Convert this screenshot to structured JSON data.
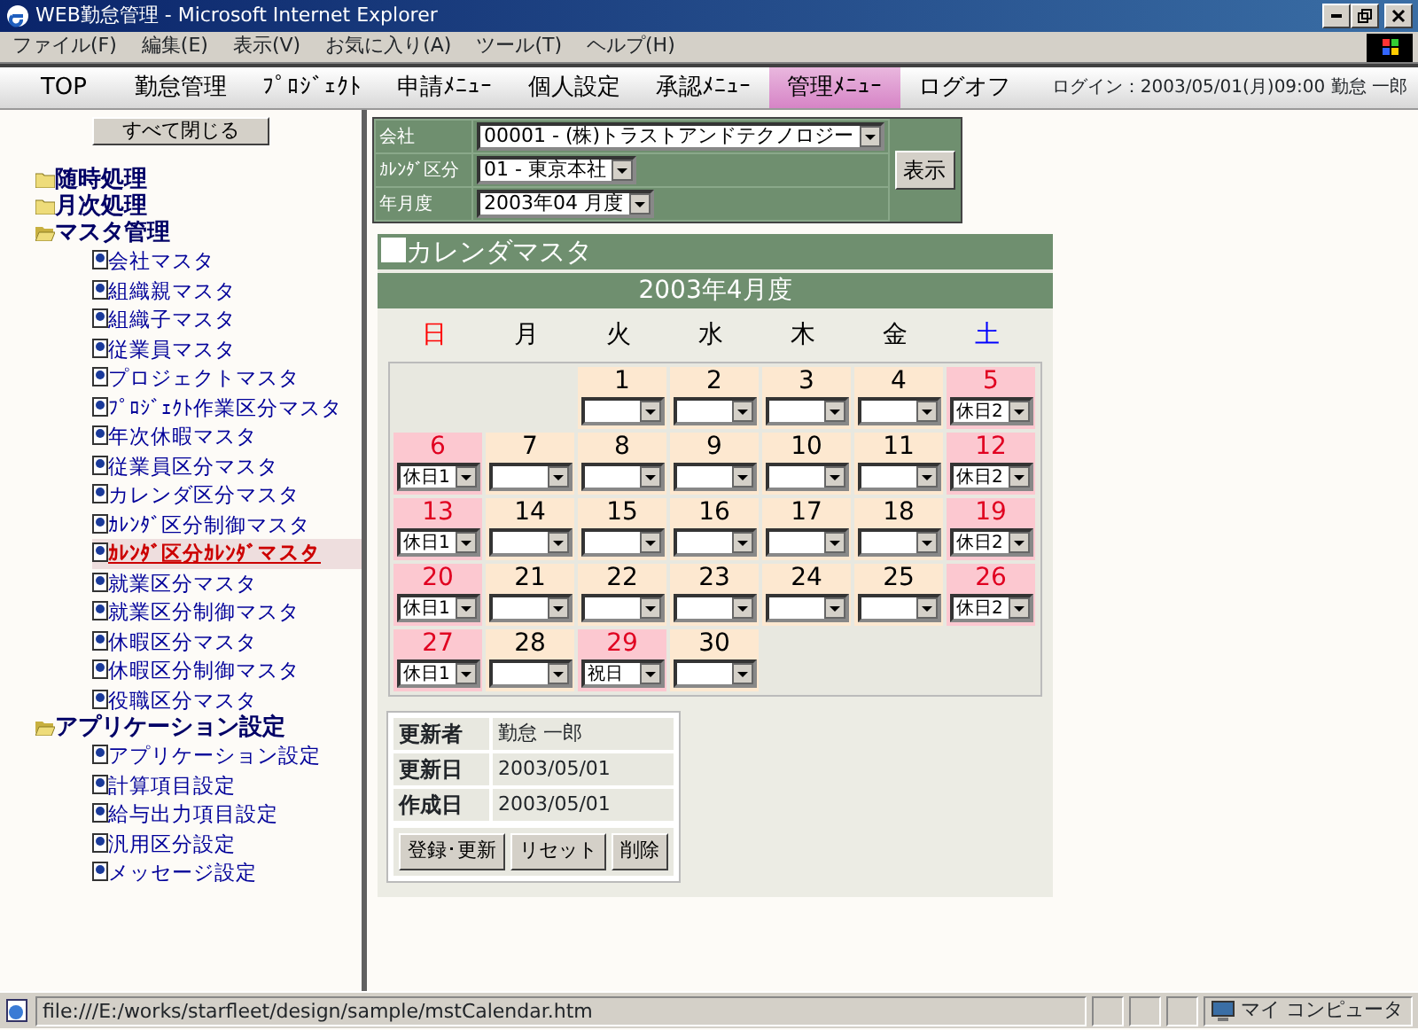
{
  "window": {
    "title": "WEB勤怠管理 - Microsoft Internet Explorer"
  },
  "menu_bar": [
    "ファイル(F)",
    "編集(E)",
    "表示(V)",
    "お気に入り(A)",
    "ツール(T)",
    "ヘルプ(H)"
  ],
  "nav_tabs": [
    {
      "label": "TOP",
      "selected": false
    },
    {
      "label": "勤怠管理",
      "selected": false
    },
    {
      "label": "ﾌﾟﾛｼﾞｪｸﾄ",
      "selected": false
    },
    {
      "label": "申請ﾒﾆｭｰ",
      "selected": false
    },
    {
      "label": "個人設定",
      "selected": false
    },
    {
      "label": "承認ﾒﾆｭｰ",
      "selected": false
    },
    {
      "label": "管理ﾒﾆｭｰ",
      "selected": true
    },
    {
      "label": "ログオフ",
      "selected": false
    }
  ],
  "login_info": "ログイン：2003/05/01(月)09:00 勤怠 一郎",
  "sidebar": {
    "collapse_button": "すべて閉じる",
    "tree": [
      {
        "label": "随時処理",
        "expanded": false
      },
      {
        "label": "月次処理",
        "expanded": false
      },
      {
        "label": "マスタ管理",
        "expanded": true,
        "children": [
          {
            "label": "会社マスタ",
            "selected": false
          },
          {
            "label": "組織親マスタ",
            "selected": false
          },
          {
            "label": "組織子マスタ",
            "selected": false
          },
          {
            "label": "従業員マスタ",
            "selected": false
          },
          {
            "label": "プロジェクトマスタ",
            "selected": false
          },
          {
            "label": "ﾌﾟﾛｼﾞｪｸﾄ作業区分マスタ",
            "selected": false
          },
          {
            "label": "年次休暇マスタ",
            "selected": false
          },
          {
            "label": "従業員区分マスタ",
            "selected": false
          },
          {
            "label": "カレンダ区分マスタ",
            "selected": false
          },
          {
            "label": "ｶﾚﾝﾀﾞ区分制御マスタ",
            "selected": false
          },
          {
            "label": "ｶﾚﾝﾀﾞ区分ｶﾚﾝﾀﾞマスタ",
            "selected": true
          },
          {
            "label": "就業区分マスタ",
            "selected": false
          },
          {
            "label": "就業区分制御マスタ",
            "selected": false
          },
          {
            "label": "休暇区分マスタ",
            "selected": false
          },
          {
            "label": "休暇区分制御マスタ",
            "selected": false
          },
          {
            "label": "役職区分マスタ",
            "selected": false
          }
        ]
      },
      {
        "label": "アプリケーション設定",
        "expanded": true,
        "children": [
          {
            "label": "アプリケーション設定",
            "selected": false
          },
          {
            "label": "計算項目設定",
            "selected": false
          },
          {
            "label": "給与出力項目設定",
            "selected": false
          },
          {
            "label": "汎用区分設定",
            "selected": false
          },
          {
            "label": "メッセージ設定",
            "selected": false
          }
        ]
      }
    ]
  },
  "filter_form": {
    "fields": [
      {
        "label": "会社",
        "value": "00001 - (株)トラストアンドテクノロジー"
      },
      {
        "label": "ｶﾚﾝﾀﾞ区分",
        "value": "01 - 東京本社"
      },
      {
        "label": "年月度",
        "value": "2003年04 月度"
      }
    ],
    "show_button": "表示"
  },
  "calendar": {
    "title": "カレンダマスタ",
    "month_heading": "2003年4月度",
    "weekdays": [
      {
        "label": "日",
        "color": "#ff0000"
      },
      {
        "label": "月",
        "color": "#000000"
      },
      {
        "label": "火",
        "color": "#000000"
      },
      {
        "label": "水",
        "color": "#000000"
      },
      {
        "label": "木",
        "color": "#000000"
      },
      {
        "label": "金",
        "color": "#000000"
      },
      {
        "label": "土",
        "color": "#0000ff"
      }
    ],
    "weeks": [
      {
        "align_end": true,
        "days": [
          {
            "day": "1",
            "holiday": false
          },
          {
            "day": "2",
            "holiday": false
          },
          {
            "day": "3",
            "holiday": false
          },
          {
            "day": "4",
            "holiday": false
          },
          {
            "day": "5",
            "holiday": true,
            "value": "休日2"
          }
        ]
      },
      {
        "days": [
          {
            "day": "6",
            "holiday": true,
            "value": "休日1"
          },
          {
            "day": "7",
            "holiday": false
          },
          {
            "day": "8",
            "holiday": false
          },
          {
            "day": "9",
            "holiday": false
          },
          {
            "day": "10",
            "holiday": false
          },
          {
            "day": "11",
            "holiday": false
          },
          {
            "day": "12",
            "holiday": true,
            "value": "休日2"
          }
        ]
      },
      {
        "days": [
          {
            "day": "13",
            "holiday": true,
            "value": "休日1"
          },
          {
            "day": "14",
            "holiday": false
          },
          {
            "day": "15",
            "holiday": false
          },
          {
            "day": "16",
            "holiday": false
          },
          {
            "day": "17",
            "holiday": false
          },
          {
            "day": "18",
            "holiday": false
          },
          {
            "day": "19",
            "holiday": true,
            "value": "休日2"
          }
        ]
      },
      {
        "days": [
          {
            "day": "20",
            "holiday": true,
            "value": "休日1"
          },
          {
            "day": "21",
            "holiday": false
          },
          {
            "day": "22",
            "holiday": false
          },
          {
            "day": "23",
            "holiday": false
          },
          {
            "day": "24",
            "holiday": false
          },
          {
            "day": "25",
            "holiday": false
          },
          {
            "day": "26",
            "holiday": true,
            "value": "休日2"
          }
        ]
      },
      {
        "days": [
          {
            "day": "27",
            "holiday": true,
            "value": "休日1"
          },
          {
            "day": "28",
            "holiday": false
          },
          {
            "day": "29",
            "holiday": true,
            "value": "祝日"
          },
          {
            "day": "30",
            "holiday": false
          }
        ]
      }
    ]
  },
  "record_info": {
    "rows": [
      {
        "label": "更新者",
        "value": "勤怠 一郎"
      },
      {
        "label": "更新日",
        "value": "2003/05/01"
      },
      {
        "label": "作成日",
        "value": "2003/05/01"
      }
    ],
    "buttons": [
      "登録･更新",
      "リセット",
      "削除"
    ]
  },
  "status_bar": {
    "url": "file:///E:/works/starfleet/design/sample/mstCalendar.htm",
    "zone": "マイ コンピュータ"
  }
}
